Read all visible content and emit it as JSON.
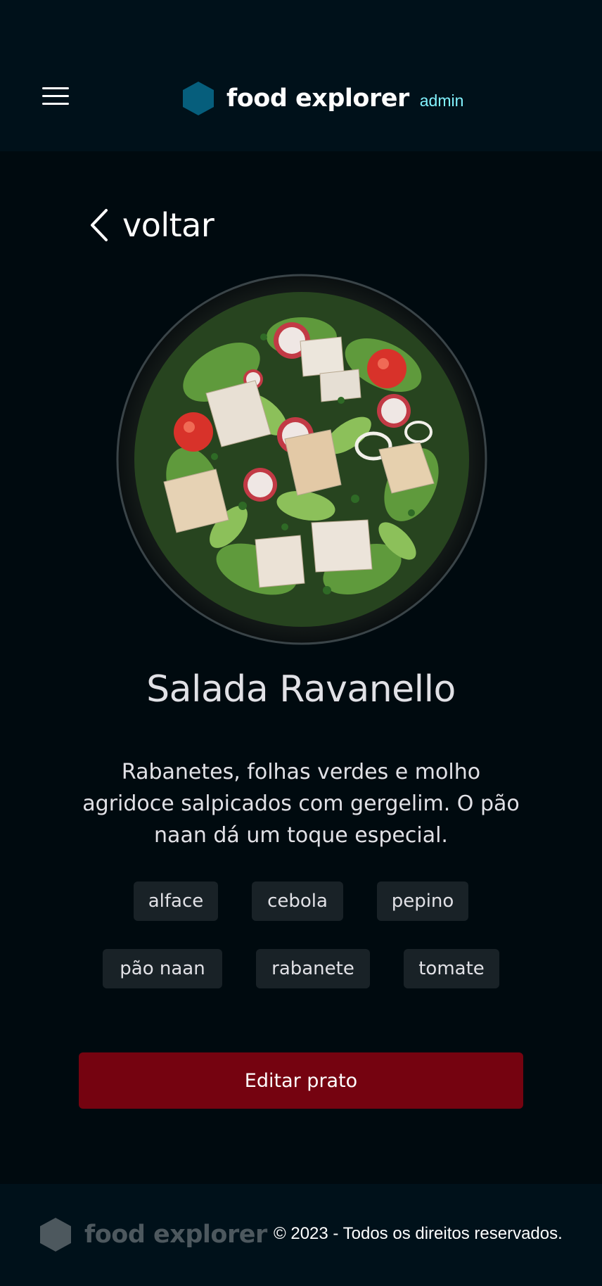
{
  "header": {
    "menu_icon": "menu-icon",
    "logo_icon": "hexagon-logo-icon",
    "brand_name": "food explorer",
    "role_badge": "admin"
  },
  "navigation": {
    "back_icon": "chevron-left-icon",
    "back_label": "voltar"
  },
  "dish": {
    "image_alt": "Salada Ravanello",
    "name": "Salada Ravanello",
    "description": "Rabanetes, folhas verdes e molho agridoce salpicados com gergelim. O pão naan dá um toque especial.",
    "ingredients": [
      "alface",
      "cebola",
      "pepino",
      "pão naan",
      "rabanete",
      "tomate"
    ]
  },
  "actions": {
    "edit_label": "Editar prato"
  },
  "footer": {
    "logo_icon": "hexagon-logo-icon",
    "brand_name": "food explorer",
    "copyright": "© 2023 - Todos os direitos reservados."
  },
  "colors": {
    "background": "#000a0f",
    "header_bg": "#00111a",
    "logo_accent": "#065e7c",
    "role_accent": "#82f3ff",
    "tag_bg": "#192227",
    "button_bg": "#750310",
    "footer_muted": "#4d585e"
  }
}
